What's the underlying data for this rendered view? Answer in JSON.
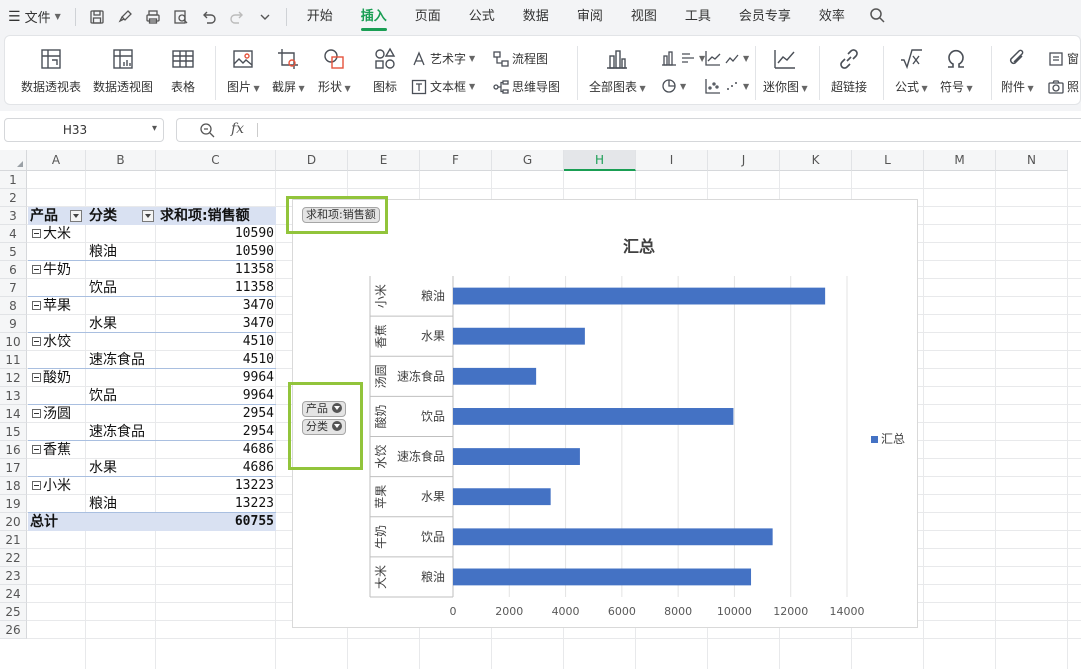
{
  "menubar": {
    "file_label": "文件",
    "tabs": [
      "开始",
      "插入",
      "页面",
      "公式",
      "数据",
      "审阅",
      "视图",
      "工具",
      "会员专享",
      "效率"
    ],
    "active_tab": "插入"
  },
  "ribbon": {
    "pivot_table": "数据透视表",
    "pivot_chart": "数据透视图",
    "table": "表格",
    "picture": "图片",
    "screenshot": "截屏",
    "shape": "形状",
    "icon": "图标",
    "wordart": "艺术字",
    "textbox": "文本框",
    "flowchart": "流程图",
    "mindmap": "思维导图",
    "all_charts": "全部图表",
    "sparkline": "迷你图",
    "hyperlink": "超链接",
    "formula": "公式",
    "symbol": "符号",
    "attachment": "附件",
    "camera_partial": "照"
  },
  "formula_bar": {
    "name_box": "H33",
    "fx_label": "fx",
    "content": ""
  },
  "columns": [
    "A",
    "B",
    "C",
    "D",
    "E",
    "F",
    "G",
    "H",
    "I",
    "J",
    "K",
    "L",
    "M",
    "N"
  ],
  "selected_column": "H",
  "rows": [
    "1",
    "2",
    "3",
    "4",
    "5",
    "6",
    "7",
    "8",
    "9",
    "10",
    "11",
    "12",
    "13",
    "14",
    "15",
    "16",
    "17",
    "18",
    "19",
    "20",
    "21",
    "22",
    "23",
    "24",
    "25",
    "26"
  ],
  "pivot": {
    "header_product": "产品",
    "header_category": "分类",
    "header_value": "求和项:销售额",
    "items": [
      {
        "product": "大米",
        "category": "粮油",
        "value": "10590"
      },
      {
        "product": "牛奶",
        "category": "饮品",
        "value": "11358"
      },
      {
        "product": "苹果",
        "category": "水果",
        "value": "3470"
      },
      {
        "product": "水饺",
        "category": "速冻食品",
        "value": "4510"
      },
      {
        "product": "酸奶",
        "category": "饮品",
        "value": "9964"
      },
      {
        "product": "汤圆",
        "category": "速冻食品",
        "value": "2954"
      },
      {
        "product": "香蕉",
        "category": "水果",
        "value": "4686"
      },
      {
        "product": "小米",
        "category": "粮油",
        "value": "13223"
      }
    ],
    "total_label": "总计",
    "total_value": "60755"
  },
  "chart_buttons": {
    "value_field": "求和项:销售额",
    "product_field": "产品",
    "category_field": "分类"
  },
  "chart_data": {
    "type": "bar",
    "orientation": "horizontal",
    "title": "汇总",
    "categories": [
      {
        "product": "小米",
        "category": "粮油"
      },
      {
        "product": "香蕉",
        "category": "水果"
      },
      {
        "product": "汤圆",
        "category": "速冻食品"
      },
      {
        "product": "酸奶",
        "category": "饮品"
      },
      {
        "product": "水饺",
        "category": "速冻食品"
      },
      {
        "product": "苹果",
        "category": "水果"
      },
      {
        "product": "牛奶",
        "category": "饮品"
      },
      {
        "product": "大米",
        "category": "粮油"
      }
    ],
    "series": [
      {
        "name": "汇总",
        "values": [
          13223,
          4686,
          2954,
          9964,
          4510,
          3470,
          11358,
          10590
        ],
        "color": "#4472c4"
      }
    ],
    "xlim": [
      0,
      14000
    ],
    "xticks": [
      "0",
      "2000",
      "4000",
      "6000",
      "8000",
      "10000",
      "12000",
      "14000"
    ],
    "grid": true,
    "legend": "right"
  }
}
